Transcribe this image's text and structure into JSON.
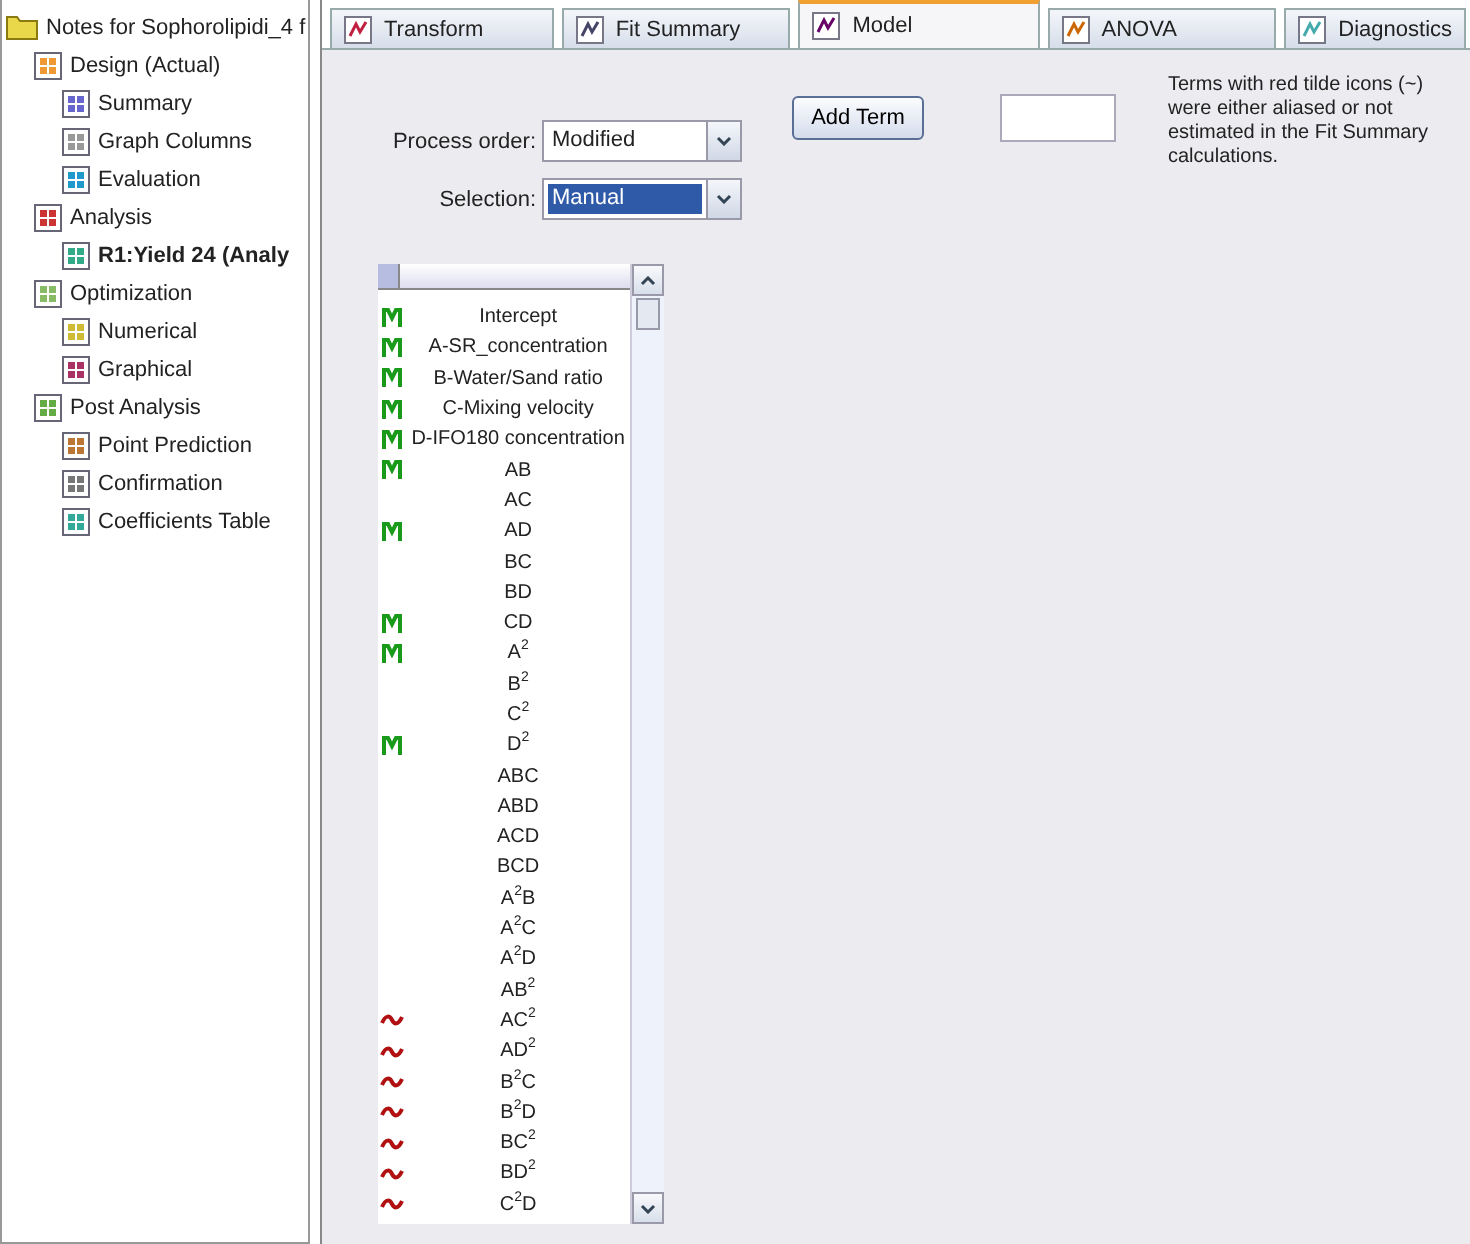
{
  "tree": {
    "label": "Notes for Sophorolipidi_4 f",
    "selected": false,
    "children": [
      {
        "label": "Design (Actual)",
        "selected": false,
        "children": [
          {
            "label": "Summary",
            "selected": false
          },
          {
            "label": "Graph Columns",
            "selected": false
          },
          {
            "label": "Evaluation",
            "selected": false
          }
        ]
      },
      {
        "label": "Analysis",
        "selected": false,
        "children": [
          {
            "label": "R1:Yield 24 (Analy",
            "selected": true
          }
        ]
      },
      {
        "label": "Optimization",
        "selected": false,
        "children": [
          {
            "label": "Numerical",
            "selected": false
          },
          {
            "label": "Graphical",
            "selected": false
          }
        ]
      },
      {
        "label": "Post Analysis",
        "selected": false,
        "children": [
          {
            "label": "Point Prediction",
            "selected": false
          },
          {
            "label": "Confirmation",
            "selected": false
          },
          {
            "label": "Coefficients Table",
            "selected": false
          }
        ]
      }
    ]
  },
  "tabs": [
    {
      "label": "Transform",
      "selected": false
    },
    {
      "label": "Fit Summary",
      "selected": false
    },
    {
      "label": "Model",
      "selected": true
    },
    {
      "label": "ANOVA",
      "selected": false
    },
    {
      "label": "Diagnostics",
      "selected": false
    }
  ],
  "add_term_button": "Add Term",
  "note": "Terms with red tilde icons (~) were either aliased or not estimated in the Fit Summary calculations.",
  "process_order": {
    "label": "Process order:",
    "value": "Modified"
  },
  "selection": {
    "label": "Selection:",
    "value": "Manual",
    "highlighted": true
  },
  "terms": [
    {
      "term": "Intercept",
      "in_model": true,
      "aliased": false
    },
    {
      "term": "A-SR_concentration",
      "in_model": true,
      "aliased": false
    },
    {
      "term": "B-Water/Sand ratio",
      "in_model": true,
      "aliased": false
    },
    {
      "term": "C-Mixing velocity",
      "in_model": true,
      "aliased": false
    },
    {
      "term": "D-IFO180 concentration",
      "in_model": true,
      "aliased": false
    },
    {
      "term": "AB",
      "in_model": true,
      "aliased": false
    },
    {
      "term": "AC",
      "in_model": false,
      "aliased": false
    },
    {
      "term": "AD",
      "in_model": true,
      "aliased": false
    },
    {
      "term": "BC",
      "in_model": false,
      "aliased": false
    },
    {
      "term": "BD",
      "in_model": false,
      "aliased": false
    },
    {
      "term": "CD",
      "in_model": true,
      "aliased": false
    },
    {
      "term": "A$^{2}$",
      "in_model": true,
      "aliased": false
    },
    {
      "term": "B$^{2}$",
      "in_model": false,
      "aliased": false
    },
    {
      "term": "C$^{2}$",
      "in_model": false,
      "aliased": false
    },
    {
      "term": "D$^{2}$",
      "in_model": true,
      "aliased": false
    },
    {
      "term": "ABC",
      "in_model": false,
      "aliased": false
    },
    {
      "term": "ABD",
      "in_model": false,
      "aliased": false
    },
    {
      "term": "ACD",
      "in_model": false,
      "aliased": false
    },
    {
      "term": "BCD",
      "in_model": false,
      "aliased": false
    },
    {
      "term": "A$^{2}$B",
      "in_model": false,
      "aliased": false
    },
    {
      "term": "A$^{2}$C",
      "in_model": false,
      "aliased": false
    },
    {
      "term": "A$^{2}$D",
      "in_model": false,
      "aliased": false
    },
    {
      "term": "AB$^{2}$",
      "in_model": false,
      "aliased": false
    },
    {
      "term": "AC$^{2}$",
      "in_model": false,
      "aliased": true
    },
    {
      "term": "AD$^{2}$",
      "in_model": false,
      "aliased": true
    },
    {
      "term": "B$^{2}$C",
      "in_model": false,
      "aliased": true
    },
    {
      "term": "B$^{2}$D",
      "in_model": false,
      "aliased": true
    },
    {
      "term": "BC$^{2}$",
      "in_model": false,
      "aliased": true
    },
    {
      "term": "BD$^{2}$",
      "in_model": false,
      "aliased": true
    },
    {
      "term": "C$^{2}$D",
      "in_model": false,
      "aliased": true
    }
  ]
}
